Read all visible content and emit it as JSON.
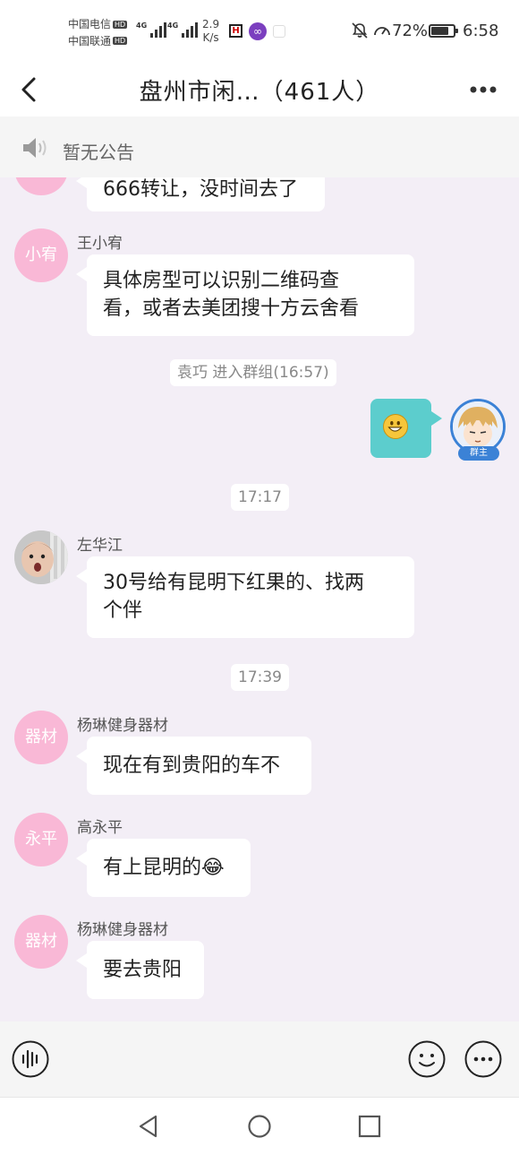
{
  "status_bar": {
    "carrier_1": "中国电信",
    "carrier_2": "中国联通",
    "hd_label": "HD",
    "network_type": "4G",
    "speed_value": "2.9",
    "speed_unit": "K/s",
    "battery_text": "72%",
    "battery_level": 0.72,
    "time": "6:58"
  },
  "header": {
    "title": "盘州市闲…（461人）"
  },
  "announcement": {
    "text": "暂无公告"
  },
  "messages": [
    {
      "type": "text",
      "text": "666转让，没时间去了"
    },
    {
      "type": "text",
      "avatar_text": "小宥",
      "sender": "王小宥",
      "line1": "具体房型可以识别二维码查",
      "line2": "看，或者去美团搜十方云舍看"
    },
    {
      "type": "system",
      "text": "袁巧 进入群组(16:57)"
    },
    {
      "type": "self",
      "content": "grinning-emoji",
      "badge": "群主"
    },
    {
      "type": "time",
      "text": "17:17"
    },
    {
      "type": "text",
      "avatar": "photo",
      "sender": "左华江",
      "line1": "30号给有昆明下红果的、找两",
      "line2": "个伴"
    },
    {
      "type": "time",
      "text": "17:39"
    },
    {
      "type": "text",
      "avatar_text": "器材",
      "sender": "杨琳健身器材",
      "text": "现在有到贵阳的车不"
    },
    {
      "type": "text",
      "avatar_text": "永平",
      "sender": "高永平",
      "text": "有上昆明的😂"
    },
    {
      "type": "text",
      "avatar_text": "器材",
      "sender": "杨琳健身器材",
      "text": "要去贵阳"
    }
  ],
  "input": {
    "value": "",
    "placeholder": ""
  },
  "colors": {
    "avatar_pink": "#f9b8d6",
    "self_bubble": "#5ccdcd",
    "chat_background": "#f3eef6",
    "owner_badge": "#3b82d6"
  }
}
